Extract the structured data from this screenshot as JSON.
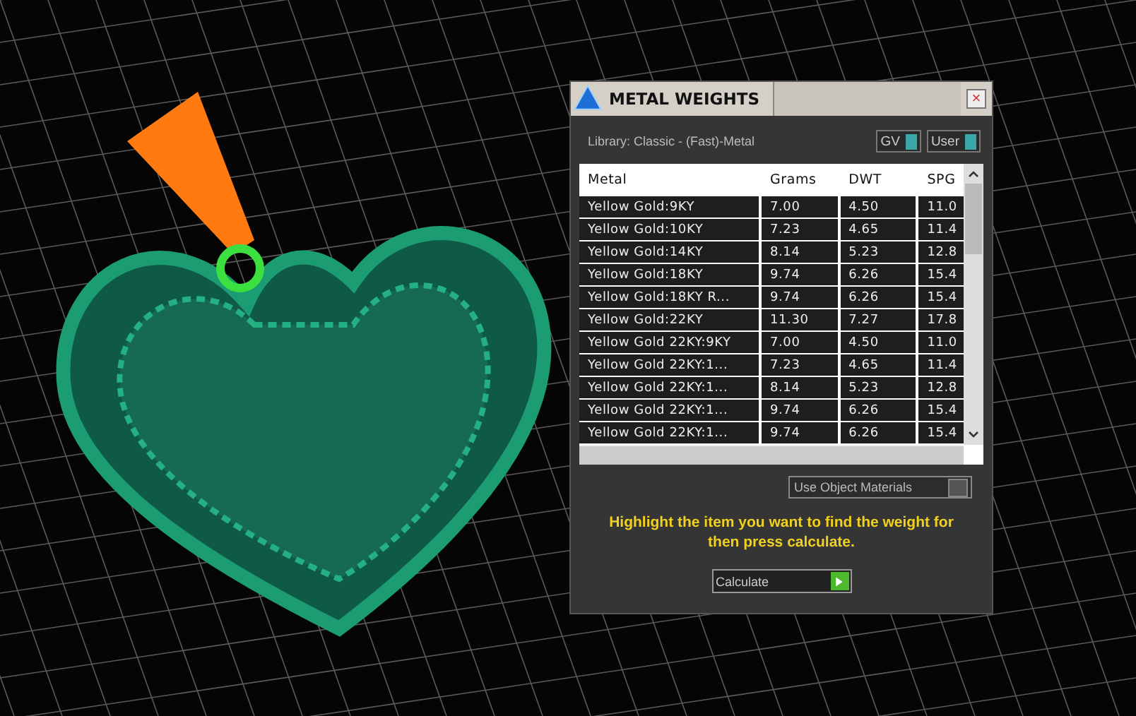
{
  "dialog": {
    "title": "METAL WEIGHTS",
    "close": "×",
    "library": "Library: Classic - (Fast)-Metal",
    "toggles": [
      {
        "label": "GV",
        "on": true
      },
      {
        "label": "User",
        "on": true
      }
    ],
    "table": {
      "columns": [
        "Metal",
        "Grams",
        "DWT",
        "SPG"
      ],
      "rows": [
        [
          "Yellow Gold:9KY",
          "7.00",
          "4.50",
          "11.0"
        ],
        [
          "Yellow Gold:10KY",
          "7.23",
          "4.65",
          "11.4"
        ],
        [
          "Yellow Gold:14KY",
          "8.14",
          "5.23",
          "12.8"
        ],
        [
          "Yellow Gold:18KY",
          "9.74",
          "6.26",
          "15.4"
        ],
        [
          "Yellow Gold:18KY R...",
          "9.74",
          "6.26",
          "15.4"
        ],
        [
          "Yellow Gold:22KY",
          "11.30",
          "7.27",
          "17.8"
        ],
        [
          "Yellow Gold 22KY:9KY",
          "7.00",
          "4.50",
          "11.0"
        ],
        [
          "Yellow Gold 22KY:1...",
          "7.23",
          "4.65",
          "11.4"
        ],
        [
          "Yellow Gold 22KY:1...",
          "8.14",
          "5.23",
          "12.8"
        ],
        [
          "Yellow Gold 22KY:1...",
          "9.74",
          "6.26",
          "15.4"
        ],
        [
          "Yellow Gold 22KY:1...",
          "9.74",
          "6.26",
          "15.4"
        ]
      ]
    },
    "use_object_materials": {
      "label": "Use Object Materials",
      "on": false
    },
    "hint": "Highlight the item you want to find the weight for then press calculate.",
    "calculate": "Calculate"
  }
}
